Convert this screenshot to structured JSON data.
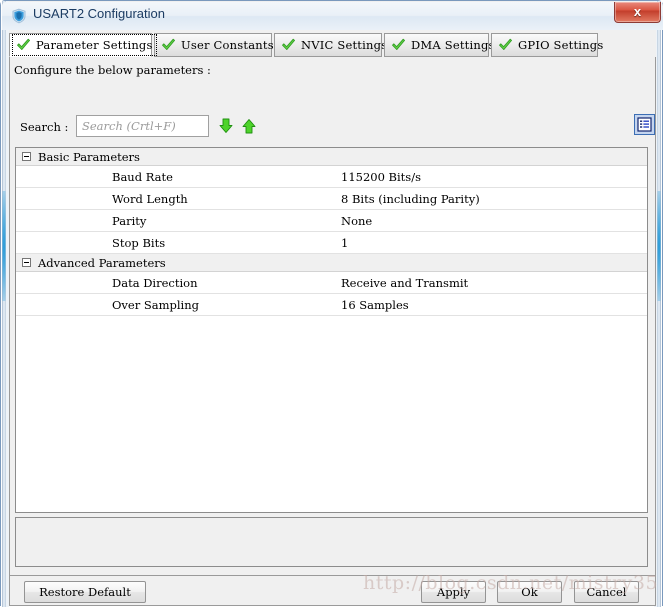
{
  "window": {
    "title": "USART2 Configuration",
    "icon": "shield-icon",
    "close_label": "x",
    "accent_color": "#0d8fd4",
    "titlebar_text_color": "#1c3c63"
  },
  "tabs": [
    {
      "label": "Parameter Settings",
      "icon": "green-check-icon",
      "active": true
    },
    {
      "label": "User Constants",
      "icon": "green-check-icon",
      "active": false
    },
    {
      "label": "NVIC Settings",
      "icon": "green-check-icon",
      "active": false
    },
    {
      "label": "DMA Settings",
      "icon": "green-check-icon",
      "active": false
    },
    {
      "label": "GPIO Settings",
      "icon": "green-check-icon",
      "active": false
    }
  ],
  "main": {
    "configure_label": "Configure the below parameters :",
    "search": {
      "label": "Search :",
      "value": "",
      "placeholder": "Search (Crtl+F)",
      "find_next_icon": "arrow-down-icon",
      "find_prev_icon": "arrow-up-icon",
      "list_view_icon": "list-view-icon"
    },
    "groups": [
      {
        "title": "Basic Parameters",
        "expanded": true,
        "rows": [
          {
            "name": "Baud Rate",
            "value": "115200 Bits/s"
          },
          {
            "name": "Word Length",
            "value": "8 Bits (including Parity)"
          },
          {
            "name": "Parity",
            "value": "None"
          },
          {
            "name": "Stop Bits",
            "value": "1"
          }
        ]
      },
      {
        "title": "Advanced Parameters",
        "expanded": true,
        "rows": [
          {
            "name": "Data Direction",
            "value": "Receive and Transmit"
          },
          {
            "name": "Over Sampling",
            "value": "16 Samples"
          }
        ]
      }
    ]
  },
  "buttons": {
    "restore_default": "Restore Default",
    "apply": "Apply",
    "ok": "Ok",
    "cancel": "Cancel"
  },
  "watermark": {
    "text": "http://blog.csdn.net/mistry35"
  }
}
